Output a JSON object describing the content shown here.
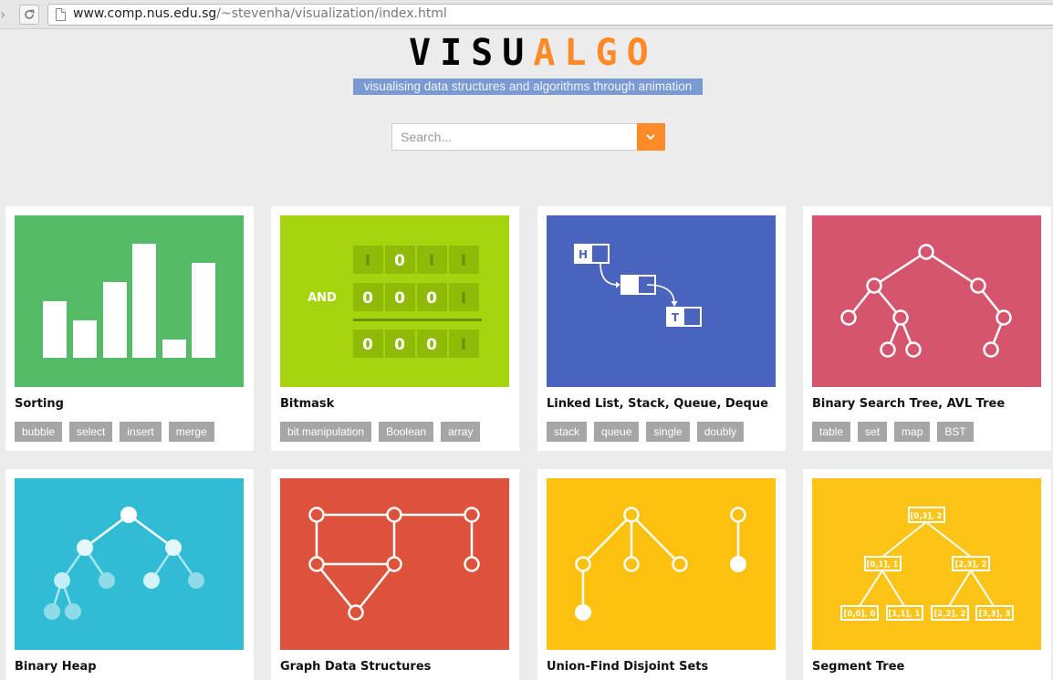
{
  "browser": {
    "url_host": "www.comp.nus.edu.sg",
    "url_path": "/~stevenha/visualization/index.html"
  },
  "header": {
    "logo_dark": "VISU",
    "logo_orange": "ALGO",
    "tagline": "visualising data structures and algorithms through animation",
    "search_placeholder": "Search..."
  },
  "colors": {
    "accent": "#ff8a27",
    "sorting": "#55bb66",
    "bitmask": "#a5d30e",
    "linked_list": "#4a63bd",
    "bst": "#d5556f",
    "heap": "#2fbcd4",
    "graph": "#dc523a",
    "union_find": "#fcc00f",
    "segment_tree": "#fcc416"
  },
  "cards": [
    {
      "title": "Sorting",
      "tags": [
        "bubble",
        "select",
        "insert",
        "merge"
      ]
    },
    {
      "title": "Bitmask",
      "tags": [
        "bit manipulation",
        "Boolean",
        "array"
      ]
    },
    {
      "title": "Linked List, Stack, Queue, Deque",
      "tags": [
        "stack",
        "queue",
        "single",
        "doubly"
      ]
    },
    {
      "title": "Binary Search Tree, AVL Tree",
      "tags": [
        "table",
        "set",
        "map",
        "BST"
      ]
    },
    {
      "title": "Binary Heap",
      "tags": []
    },
    {
      "title": "Graph Data Structures",
      "tags": []
    },
    {
      "title": "Union-Find Disjoint Sets",
      "tags": []
    },
    {
      "title": "Segment Tree",
      "tags": []
    }
  ],
  "bitmask_art": {
    "op_label": "AND",
    "row1": [
      "I",
      "0",
      "I",
      "I"
    ],
    "row2": [
      "0",
      "0",
      "0",
      "I"
    ],
    "row3": [
      "0",
      "0",
      "0",
      "I"
    ]
  },
  "linked_list_art": {
    "head": "H",
    "tail": "T"
  },
  "segment_tree_art": {
    "root": "[0,3], 2",
    "left": "[0,1], 1",
    "right": "[2,3], 2",
    "leaves": [
      "[0,0], 0",
      "[1,1], 1",
      "[2,2], 2",
      "[3,3], 3"
    ]
  }
}
